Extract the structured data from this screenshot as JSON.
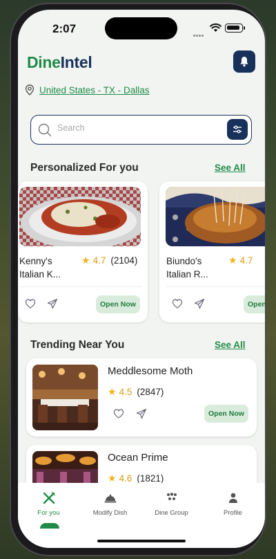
{
  "status_bar": {
    "time": "2:07"
  },
  "brand": {
    "logo_dine": "Dine",
    "logo_intel": "Intel"
  },
  "location": {
    "text": "United States - TX - Dallas"
  },
  "search": {
    "placeholder": "Search"
  },
  "personalized": {
    "title": "Personalized For you",
    "see_all": "See All",
    "cards": [
      {
        "name": "Kenny's Italian K...",
        "rating": "4.7",
        "reviews": "(2104)",
        "status": "Open Now"
      },
      {
        "name": "Biundo's Italian R...",
        "rating": "4.7",
        "reviews": "",
        "status": "Open Now"
      }
    ]
  },
  "trending": {
    "title": "Trending Near You",
    "see_all": "See All",
    "items": [
      {
        "name": "Meddlesome Moth",
        "rating": "4.5",
        "reviews": "(2847)",
        "status": "Open Now"
      },
      {
        "name": "Ocean Prime",
        "rating": "4.6",
        "reviews": "(1821)"
      }
    ]
  },
  "tabs": [
    {
      "label": "For you",
      "icon": "fork-knife-icon",
      "active": true
    },
    {
      "label": "Modify Dish",
      "icon": "cloche-icon",
      "active": false
    },
    {
      "label": "Dine Group",
      "icon": "group-icon",
      "active": false
    },
    {
      "label": "Profile",
      "icon": "person-icon",
      "active": false
    }
  ],
  "colors": {
    "brand_green": "#1f8b47",
    "brand_navy": "#17315a",
    "star": "#f3b21a"
  }
}
